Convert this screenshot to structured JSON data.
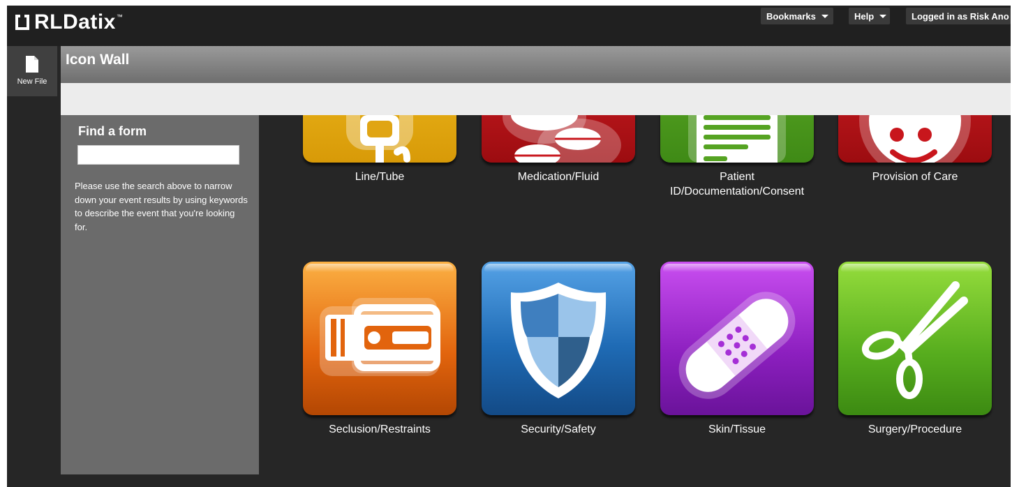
{
  "header": {
    "brand": "RLDatix",
    "brand_tm": "™",
    "bookmarks_label": "Bookmarks",
    "help_label": "Help",
    "user_label": "Logged in as Risk Ano"
  },
  "rail": {
    "new_file_label": "New File",
    "new_file_icon": "document-icon"
  },
  "page": {
    "title": "Icon Wall"
  },
  "sidebar": {
    "find_title": "Find a form",
    "search_value": "",
    "help_text": "Please use the search above to narrow down your event results by using keywords to describe the event that you're looking for."
  },
  "tiles": [
    {
      "label": "Line/Tube",
      "icon": "iv-bag-icon",
      "color": "#f0b516"
    },
    {
      "label": "Medication/Fluid",
      "icon": "pills-icon",
      "color": "#c8161c"
    },
    {
      "label": "Patient ID/Documentation/Consent",
      "icon": "document-icon",
      "color": "#55a322"
    },
    {
      "label": "Provision of Care",
      "icon": "smiley-icon",
      "color": "#c8161c"
    },
    {
      "label": "Seclusion/Restraints",
      "icon": "restraint-belt-icon",
      "color": "#f28a1e"
    },
    {
      "label": "Security/Safety",
      "icon": "shield-icon",
      "color": "#2a7cc8"
    },
    {
      "label": "Skin/Tissue",
      "icon": "bandage-icon",
      "color": "#a52fd6"
    },
    {
      "label": "Surgery/Procedure",
      "icon": "scissors-icon",
      "color": "#6cc02a"
    }
  ]
}
